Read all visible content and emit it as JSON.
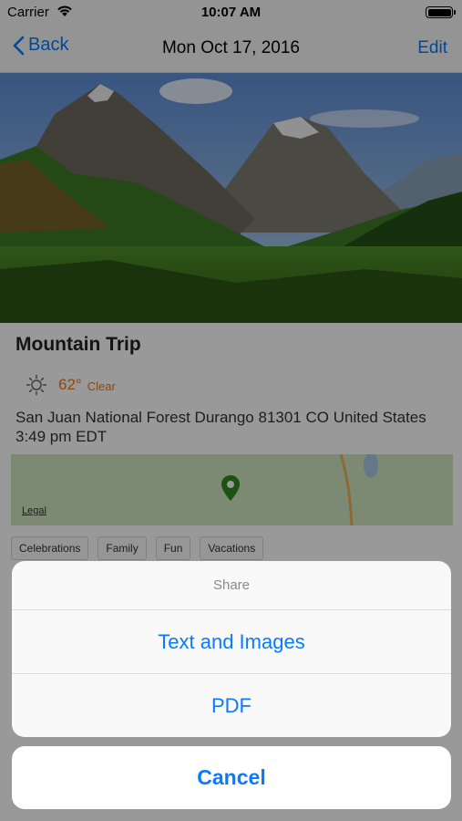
{
  "status_bar": {
    "carrier": "Carrier",
    "time": "10:07 AM"
  },
  "nav": {
    "back_label": "Back",
    "title": "Mon Oct 17, 2016",
    "edit_label": "Edit"
  },
  "entry": {
    "title": "Mountain Trip",
    "weather": {
      "icon": "sun-icon",
      "temperature": "62°",
      "condition": "Clear"
    },
    "location": "San Juan National Forest Durango 81301 CO United States",
    "time": "3:49 pm EDT",
    "map": {
      "legal_label": "Legal"
    },
    "tags": [
      "Celebrations",
      "Family",
      "Fun",
      "Vacations"
    ]
  },
  "action_sheet": {
    "title": "Share",
    "options": [
      "Text and Images",
      "PDF"
    ],
    "cancel_label": "Cancel"
  },
  "colors": {
    "accent": "#007aff",
    "weather": "#e87b14",
    "map_pin": "#2e8b1f"
  }
}
